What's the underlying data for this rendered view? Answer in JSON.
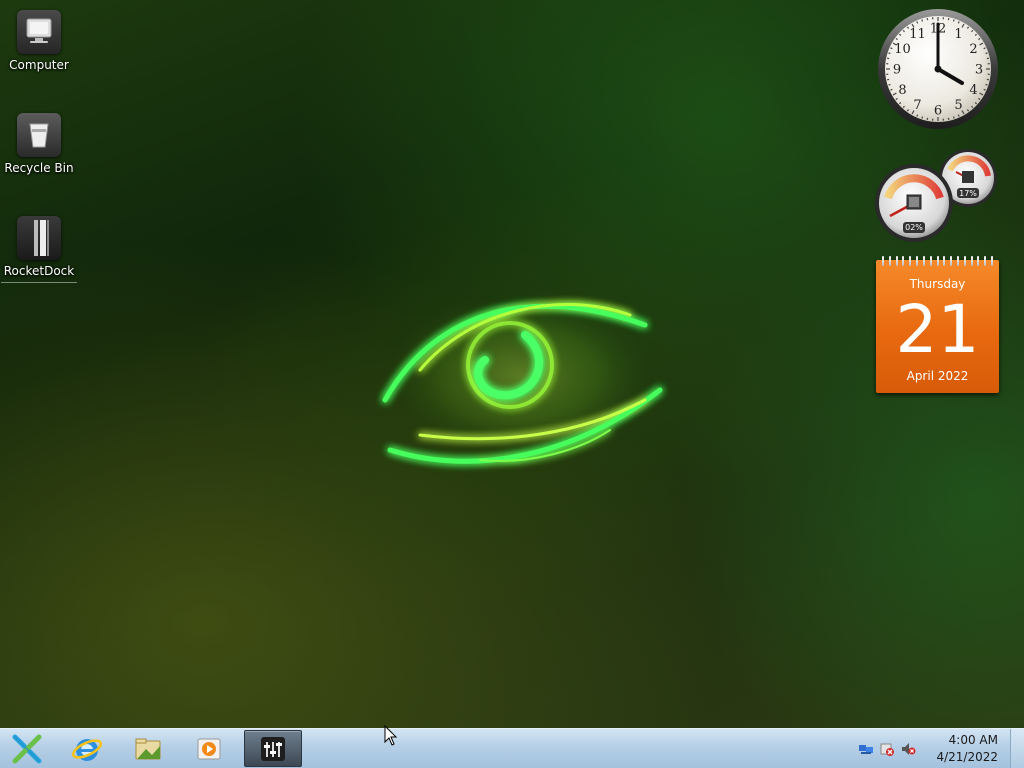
{
  "desktop": {
    "icons": [
      {
        "label": "Computer",
        "icon": "computer-icon"
      },
      {
        "label": "Recycle Bin",
        "icon": "recycle-bin-icon"
      },
      {
        "label": "RocketDock",
        "icon": "rocketdock-icon"
      }
    ],
    "wallpaper": "green-glowing-eye"
  },
  "gadgets": {
    "clock": {
      "numerals": [
        "12",
        "1",
        "2",
        "3",
        "4",
        "5",
        "6",
        "7",
        "8",
        "9",
        "10",
        "11"
      ],
      "time": "4:00"
    },
    "cpu_meter": {
      "cpu_value": "02%",
      "ram_value": "17%"
    },
    "calendar": {
      "weekday": "Thursday",
      "day": "21",
      "month_year": "April 2022"
    }
  },
  "taskbar": {
    "start_icon": "start-x-icon",
    "pinned": [
      {
        "icon": "internet-explorer-icon"
      },
      {
        "icon": "file-explorer-icon"
      },
      {
        "icon": "media-player-icon"
      },
      {
        "icon": "mixer-settings-icon",
        "active": true
      }
    ],
    "tray": {
      "icons": [
        "network-icon",
        "action-center-icon",
        "volume-muted-icon"
      ],
      "time": "4:00 AM",
      "date": "4/21/2022"
    }
  },
  "colors": {
    "calendar_accent": "#e8690f",
    "taskbar": "#b5cfe6",
    "glow": "#3cff5a"
  }
}
